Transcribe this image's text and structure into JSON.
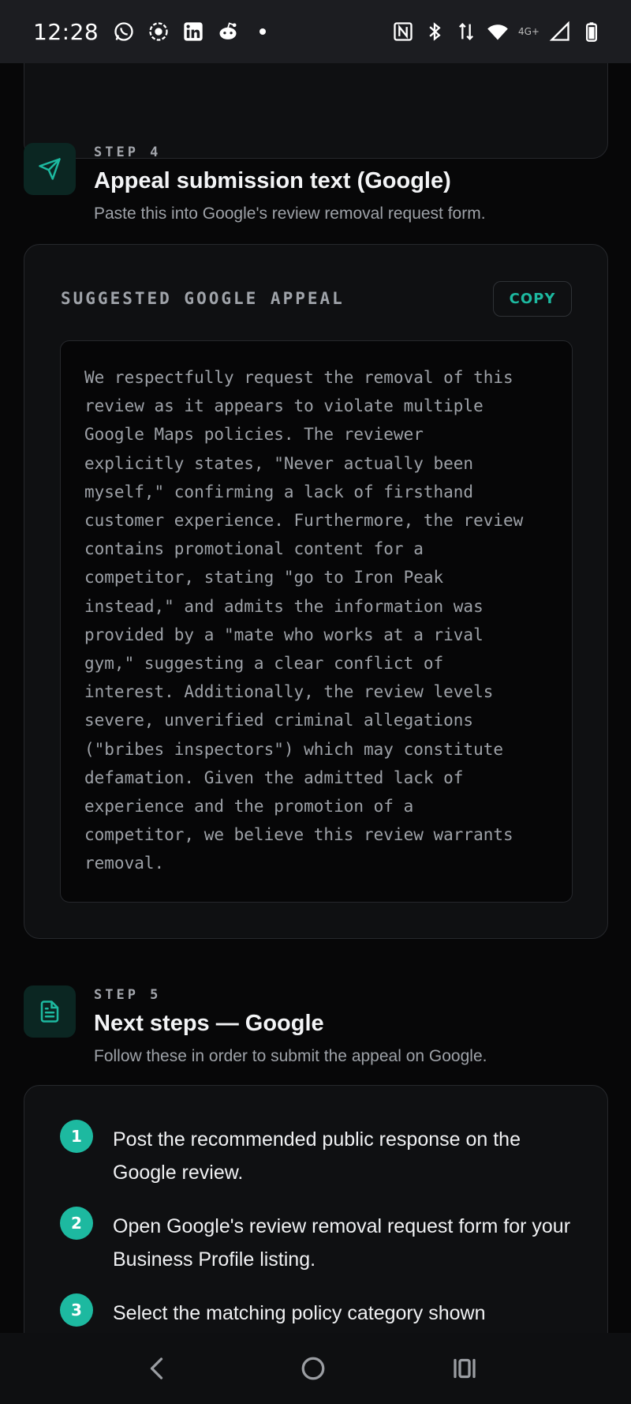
{
  "status_bar": {
    "time": "12:28",
    "left_icons": [
      "whatsapp-icon",
      "record-icon",
      "linkedin-icon",
      "reddit-icon"
    ],
    "network_label": "4G+"
  },
  "step4": {
    "label": "STEP 4",
    "title": "Appeal submission text (Google)",
    "subtitle": "Paste this into Google's review removal request form.",
    "icon": "send-icon"
  },
  "appeal": {
    "heading": "SUGGESTED GOOGLE APPEAL",
    "copy_label": "COPY",
    "text": "We respectfully request the removal of this\nreview as it appears to violate multiple\nGoogle Maps policies. The reviewer\nexplicitly states, \"Never actually been\nmyself,\" confirming a lack of firsthand\ncustomer experience. Furthermore, the review\ncontains promotional content for a\ncompetitor, stating \"go to Iron Peak\ninstead,\" and admits the information was\nprovided by a \"mate who works at a rival\ngym,\" suggesting a clear conflict of\ninterest. Additionally, the review levels\nsevere, unverified criminal allegations\n(\"bribes inspectors\") which may constitute\ndefamation. Given the admitted lack of\nexperience and the promotion of a\ncompetitor, we believe this review warrants\nremoval."
  },
  "step5": {
    "label": "STEP 5",
    "title": "Next steps — Google",
    "subtitle": "Follow these in order to submit the appeal on Google.",
    "icon": "document-icon"
  },
  "next_steps": [
    {
      "number": "1",
      "text": "Post the recommended public response on the Google review."
    },
    {
      "number": "2",
      "text": "Open Google's review removal request form for your Business Profile listing."
    },
    {
      "number": "3",
      "text": "Select the matching policy category shown"
    }
  ],
  "colors": {
    "accent": "#1db9a0",
    "background": "#070708",
    "card": "#0f1012"
  }
}
